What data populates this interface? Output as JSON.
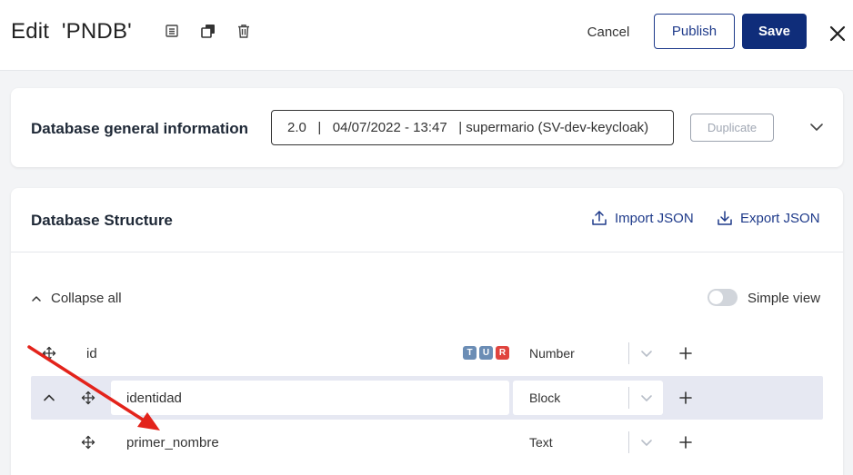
{
  "header": {
    "title": "Edit  'PNDB'",
    "icons": [
      "list-icon",
      "copy-icon",
      "trash-icon",
      "close-icon"
    ],
    "cancel_label": "Cancel",
    "publish_label": "Publish",
    "save_label": "Save"
  },
  "general_info": {
    "title": "Database general information",
    "version_text": "2.0   |   04/07/2022 - 13:47   | supermario (SV-dev-keycloak)",
    "duplicate_label": "Duplicate"
  },
  "structure": {
    "title": "Database Structure",
    "import_label": "Import JSON",
    "export_label": "Export JSON",
    "collapse_all_label": "Collapse all",
    "simple_view_label": "Simple view",
    "simple_view_on": false,
    "rows": [
      {
        "name": "id",
        "type": "Number",
        "badges": [
          "T",
          "U",
          "R"
        ]
      },
      {
        "name": "identidad",
        "type": "Block",
        "badges": []
      },
      {
        "name": "primer_nombre",
        "type": "Text",
        "badges": []
      }
    ]
  },
  "colors": {
    "accent": "#0f2d7a",
    "link": "#1e3a8a",
    "badge_t": "#6b8db5",
    "badge_u": "#6b8db5",
    "badge_r": "#e0443e",
    "highlight_row": "#e6e8f2",
    "annotation_arrow": "#e3231b"
  }
}
